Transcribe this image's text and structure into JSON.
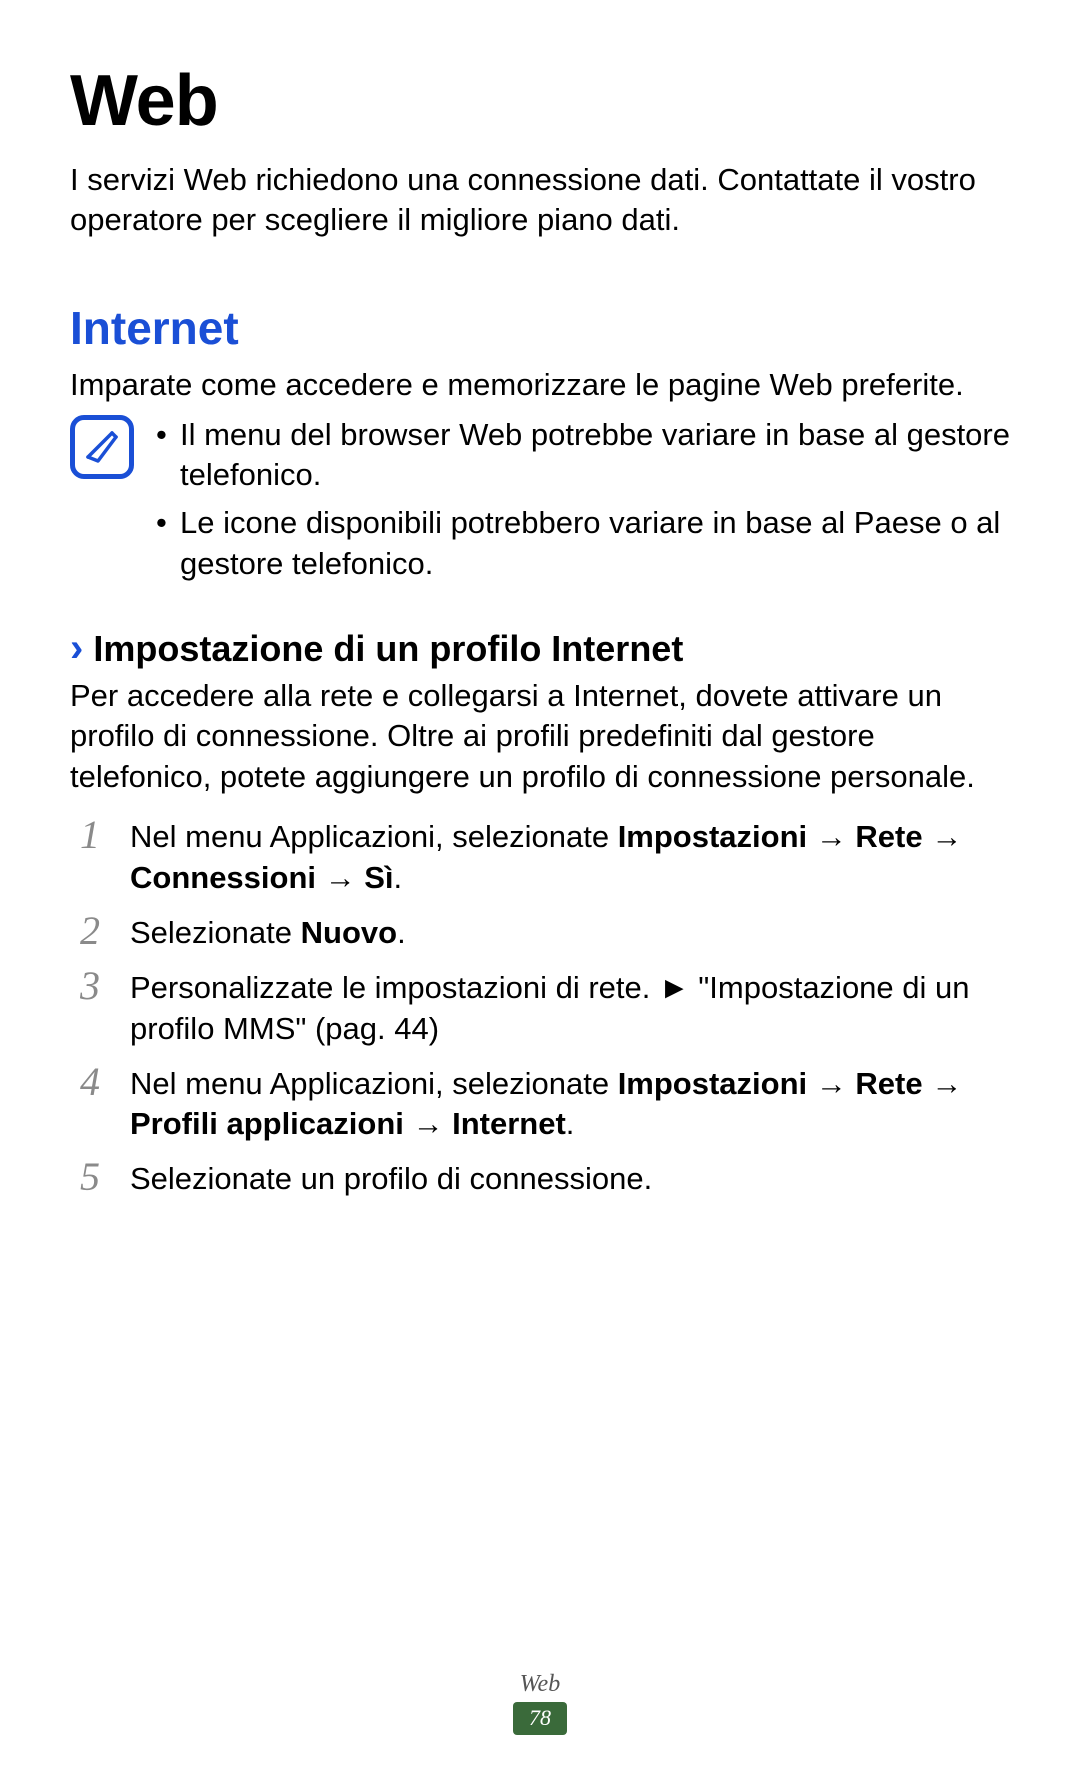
{
  "title": "Web",
  "intro": "I servizi Web richiedono una connessione dati. Contattate il vostro operatore per scegliere il migliore piano dati.",
  "section": {
    "heading": "Internet",
    "desc": "Imparate come accedere e memorizzare le pagine Web preferite.",
    "notes": [
      "Il menu del browser Web potrebbe variare in base al gestore telefonico.",
      "Le icone disponibili potrebbero variare in base al Paese o al gestore telefonico."
    ],
    "sub": {
      "heading": "Impostazione di un profilo Internet",
      "desc": "Per accedere alla rete e collegarsi a Internet, dovete attivare un profilo di connessione. Oltre ai profili predefiniti dal gestore telefonico, potete aggiungere un profilo di connessione personale.",
      "steps": [
        "Nel menu Applicazioni, selezionate <b>Impostazioni</b> → <b>Rete</b> → <b>Connessioni</b> → <b>Sì</b>.",
        "Selezionate <b>Nuovo</b>.",
        "Personalizzate le impostazioni di rete. ► \"Impostazione di un profilo MMS\" (pag. 44)",
        "Nel menu Applicazioni, selezionate <b>Impostazioni</b> → <b>Rete</b> → <b>Profili applicazioni</b> → <b>Internet</b>.",
        "Selezionate un profilo di connessione."
      ]
    }
  },
  "footer": {
    "title": "Web",
    "page": "78"
  }
}
